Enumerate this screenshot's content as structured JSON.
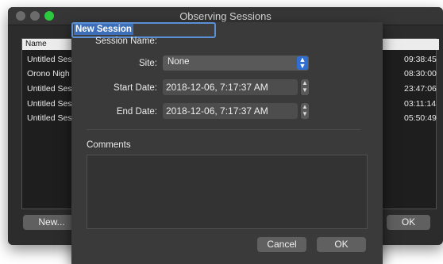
{
  "window": {
    "title": "Observing Sessions",
    "table": {
      "column_name": "Name",
      "rows": [
        {
          "name": "Untitled Ses",
          "time": "09:38:45"
        },
        {
          "name": "Orono Nigh",
          "time": "08:30:00"
        },
        {
          "name": "Untitled Ses",
          "time": "23:47:06"
        },
        {
          "name": "Untitled Ses",
          "time": "03:11:14"
        },
        {
          "name": "Untitled Ses",
          "time": "05:50:49"
        }
      ]
    },
    "new_button": "New...",
    "ok_button": "OK"
  },
  "sheet": {
    "session_name_label": "Session Name:",
    "session_name_value": "New Session",
    "site_label": "Site:",
    "site_value": "None",
    "start_date_label": "Start Date:",
    "start_date_value": "2018-12-06,   7:17:37 AM",
    "end_date_label": "End Date:",
    "end_date_value": "2018-12-06,   7:17:37 AM",
    "comments_label": "Comments",
    "comments_value": "",
    "cancel_button": "Cancel",
    "ok_button": "OK"
  },
  "colors": {
    "accent": "#2f6fd3",
    "selection": "#3d6fb8",
    "close_light": "#6b6b6b",
    "zoom_light": "#2bc840"
  },
  "icons": {
    "select_arrow": "chevron-updown-icon",
    "stepper": "stepper-icon"
  }
}
